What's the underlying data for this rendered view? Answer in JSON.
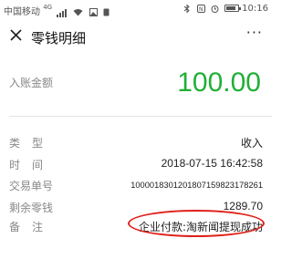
{
  "status_bar": {
    "carrier": "中国移动",
    "network": "4G",
    "time": "10:16",
    "battery_level": 0.85
  },
  "nav": {
    "title": "零钱明细",
    "more": "···"
  },
  "amount": {
    "label": "入账金额",
    "value": "100.00",
    "color": "#20b036"
  },
  "details": [
    {
      "label": "类型",
      "value": "收入"
    },
    {
      "label": "时间",
      "value": "2018-07-15 16:42:58"
    },
    {
      "label": "交易单号",
      "value": "1000018301201807159823178261"
    },
    {
      "label": "剩余零钱",
      "value": "1289.70"
    },
    {
      "label": "备注",
      "value": "企业付款:淘新闻提现成功"
    }
  ],
  "annotation_color": "#e0201a"
}
